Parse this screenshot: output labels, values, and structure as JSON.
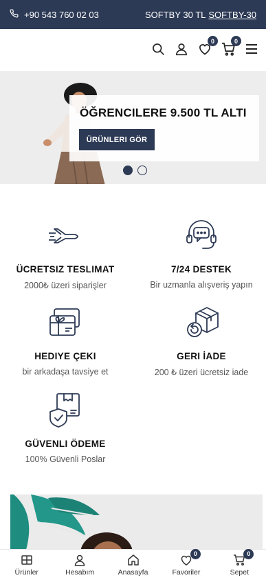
{
  "topbar": {
    "phone": "+90 543 760 02 03",
    "promo_text": "SOFTBY 30 TL",
    "promo_code": "SOFTBY-30"
  },
  "header": {
    "favorites_count": "0",
    "cart_count": "0"
  },
  "hero": {
    "title": "ÖĞRENCILERE 9.500 TL ALTI",
    "button_label": "ÜRÜNLERI GÖR",
    "slide_count": 2,
    "active_slide": 1
  },
  "features": [
    {
      "icon": "airplane-icon",
      "title": "ÜCRETSIZ TESLIMAT",
      "subtitle": "2000₺ üzeri siparişler"
    },
    {
      "icon": "headset-icon",
      "title": "7/24 DESTEK",
      "subtitle": "Bir uzmanla alışveriş yapın"
    },
    {
      "icon": "gift-card-icon",
      "title": "HEDIYE ÇEKI",
      "subtitle": "bir arkadaşa tavsiye et"
    },
    {
      "icon": "return-box-icon",
      "title": "GERI İADE",
      "subtitle": "200 ₺ üzeri ücretsiz iade"
    },
    {
      "icon": "shield-box-icon",
      "title": "GÜVENLI ÖDEME",
      "subtitle": "100% Güvenli Poslar"
    }
  ],
  "bottom_nav": {
    "products": "Ürünler",
    "account": "Hesabım",
    "home": "Anasayfa",
    "favorites": "Favoriler",
    "favorites_count": "0",
    "cart": "Sepet",
    "cart_count": "0"
  },
  "colors": {
    "primary": "#2d3a55",
    "icon_stroke": "#2d3a55",
    "hero_bg": "#ededed",
    "teal_leaf": "#1f8c80"
  }
}
